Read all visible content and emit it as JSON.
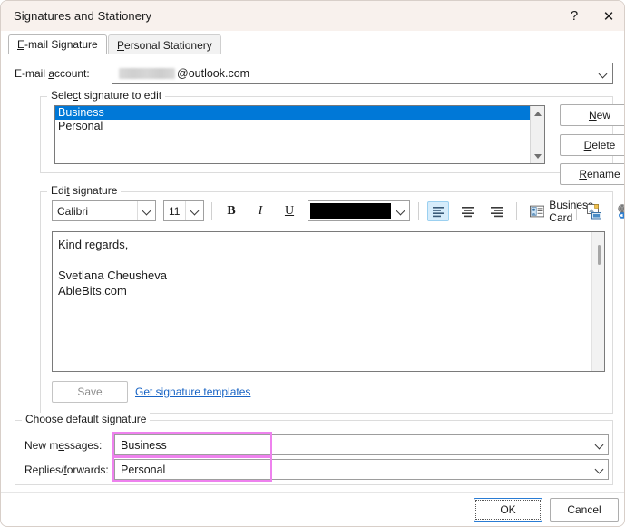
{
  "window": {
    "title": "Signatures and Stationery",
    "help_icon": "?",
    "close_icon": "✕"
  },
  "tabs": [
    {
      "label_pre": "",
      "accel": "E",
      "label_post": "-mail Signature",
      "active": true,
      "name": "tab-email-signature"
    },
    {
      "label_pre": "",
      "accel": "P",
      "label_post": "ersonal Stationery",
      "active": false,
      "name": "tab-personal-stationery"
    }
  ],
  "account": {
    "label_pre": "E-mail ",
    "label_accel": "a",
    "label_post": "ccount:",
    "value": "@outlook.com",
    "redacted": true
  },
  "select_group": {
    "title_pre": "Sele",
    "title_accel": "c",
    "title_post": "t signature to edit",
    "items": [
      {
        "label": "Business",
        "selected": true
      },
      {
        "label": "Personal",
        "selected": false
      }
    ],
    "buttons": [
      {
        "pre": "",
        "accel": "N",
        "post": "ew",
        "name": "new-signature-button"
      },
      {
        "pre": "",
        "accel": "D",
        "post": "elete",
        "name": "delete-signature-button"
      },
      {
        "pre": "",
        "accel": "R",
        "post": "ename",
        "name": "rename-signature-button"
      }
    ]
  },
  "edit_group": {
    "title_pre": "Edi",
    "title_accel": "t",
    "title_post": " signature",
    "toolbar": {
      "font_name": "Calibri",
      "font_size": "11",
      "bold": "B",
      "italic": "I",
      "underline": "U",
      "font_color": "#000000",
      "align_left_selected": true,
      "business_card_pre": "",
      "business_card_accel": "B",
      "business_card_post": "usiness Card"
    },
    "signature_text": "Kind regards,\n\nSvetlana Cheusheva\nAbleBits.com",
    "save_label": "Save",
    "save_enabled": false,
    "templates_link": "Get signature templates"
  },
  "default_group": {
    "title": "Choose default signature",
    "rows": [
      {
        "label_pre": "New m",
        "label_accel": "e",
        "label_post": "ssages:",
        "value": "Business",
        "highlighted": true,
        "name": "new-messages-signature-select"
      },
      {
        "label_pre": "Replies/",
        "label_accel": "f",
        "label_post": "orwards:",
        "value": "Personal",
        "highlighted": true,
        "name": "replies-forwards-signature-select"
      }
    ]
  },
  "footer": {
    "ok_label": "OK",
    "cancel_label": "Cancel"
  },
  "colors": {
    "titlebar_bg": "#f8f1ed",
    "selection_blue": "#0078d7",
    "highlight_magenta": "#ee82ee",
    "link_blue": "#1763c4",
    "toolbar_toggle_bg": "#d6ecfb"
  }
}
